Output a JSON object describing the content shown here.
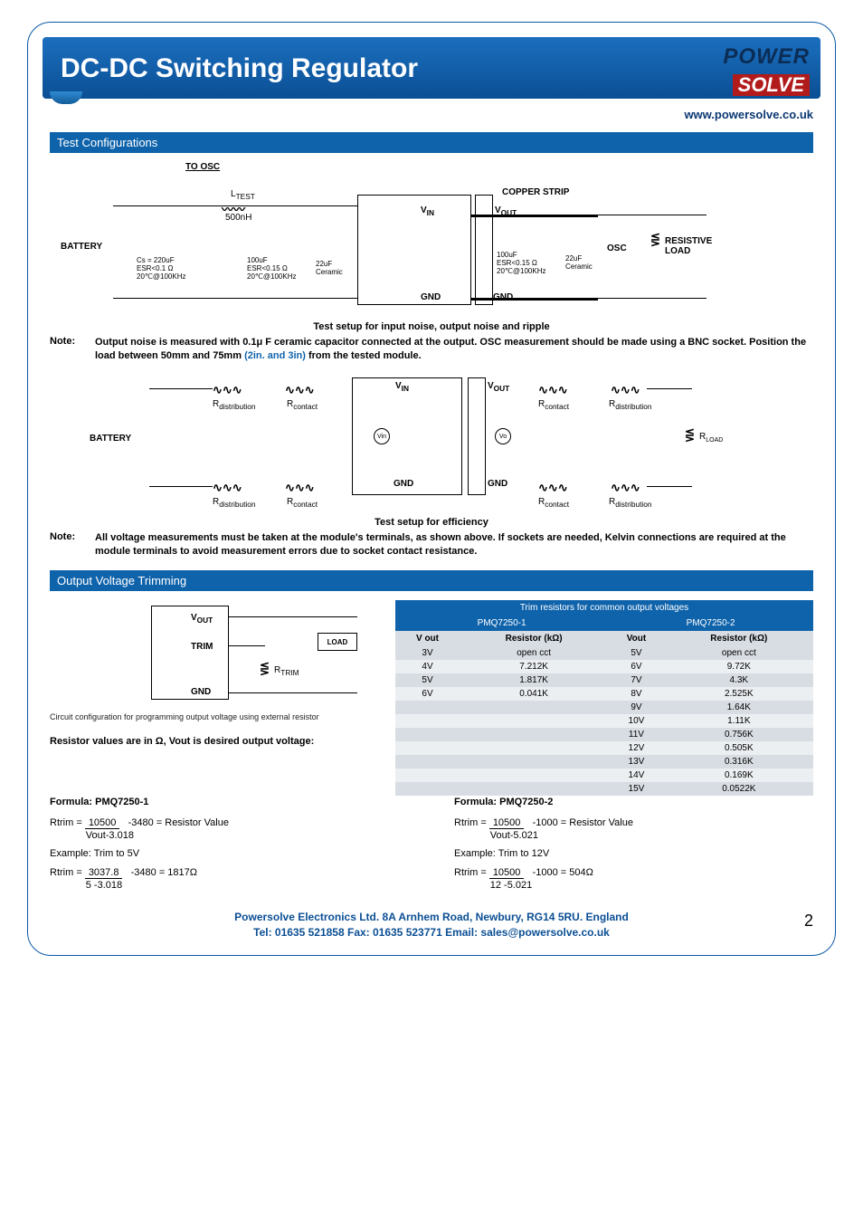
{
  "banner": {
    "title": "DC-DC Switching Regulator"
  },
  "logo": {
    "line1": "POWER",
    "line2": "SOLVE"
  },
  "url": "www.powersolve.co.uk",
  "sections": {
    "test_config": "Test Configurations",
    "trimming": "Output Voltage Trimming"
  },
  "diagram1": {
    "to_osc": "TO OSC",
    "ltest": "L",
    "ltest_sub": "TEST",
    "ltest_val": "500nH",
    "battery": "BATTERY",
    "cs": "Cs = 220uF\nESR<0.1 Ω\n20℃@100KHz",
    "c100": "100uF\nESR<0.15 Ω\n20℃@100KHz",
    "c22": "22uF\nCeramic",
    "vin": "V",
    "vin_sub": "IN",
    "gnd": "GND",
    "vout": "V",
    "vout_sub": "OUT",
    "c100b": "100uF\nESR<0.15 Ω\n20℃@100KHz",
    "c22b": "22uF\nCeramic",
    "osc": "OSC",
    "resload": "RESISTIVE\nLOAD",
    "copper": "COPPER STRIP",
    "caption": "Test setup for input noise, output noise and ripple"
  },
  "note1": {
    "label": "Note:",
    "text": "Output noise is measured with 0.1μ F ceramic capacitor connected at the output. OSC measurement should be made using a BNC socket. Position the load between 50mm and 75mm (2in. and 3in) from the tested module.",
    "paren": "(2in. and 3in)"
  },
  "diagram2": {
    "battery": "BATTERY",
    "rdist": "R",
    "rdist_sub": "distribution",
    "rcont": "R",
    "rcont_sub": "contact",
    "vin": "V",
    "vin_sub": "IN",
    "gnd": "GND",
    "vout": "V",
    "vout_sub": "OUT",
    "rload": "R",
    "rload_sub": "LOAD",
    "vin_circ": "Vin",
    "vo_circ": "Vo",
    "caption": "Test setup for efficiency"
  },
  "note2": {
    "label": "Note:",
    "text": "All voltage measurements must be taken at the module's terminals, as shown above. If sockets are needed, Kelvin connections are required at the module terminals to avoid measurement errors due to socket contact resistance."
  },
  "trim_circuit": {
    "vout": "V",
    "vout_sub": "OUT",
    "trim": "TRIM",
    "gnd": "GND",
    "load": "LOAD",
    "rtrim": "R",
    "rtrim_sub": "TRIM",
    "caption": "Circuit configuration for programming output voltage using external resistor"
  },
  "trim_note": "Resistor values are in Ω, Vout is desired output voltage:",
  "trim_table": {
    "title": "Trim resistors for common output voltages",
    "col1_hdr": "PMQ7250-1",
    "col2_hdr": "PMQ7250-2",
    "sub": [
      "V out",
      "Resistor (kΩ)",
      "Vout",
      "Resistor (kΩ)"
    ],
    "rows": [
      [
        "3V",
        "open cct",
        "5V",
        "open cct"
      ],
      [
        "4V",
        "7.212K",
        "6V",
        "9.72K"
      ],
      [
        "5V",
        "1.817K",
        "7V",
        "4.3K"
      ],
      [
        "6V",
        "0.041K",
        "8V",
        "2.525K"
      ],
      [
        "",
        "",
        "9V",
        "1.64K"
      ],
      [
        "",
        "",
        "10V",
        "1.11K"
      ],
      [
        "",
        "",
        "11V",
        "0.756K"
      ],
      [
        "",
        "",
        "12V",
        "0.505K"
      ],
      [
        "",
        "",
        "13V",
        "0.316K"
      ],
      [
        "",
        "",
        "14V",
        "0.169K"
      ],
      [
        "",
        "",
        "15V",
        "0.0522K"
      ]
    ]
  },
  "formula1": {
    "header": "Formula:   PMQ7250-1",
    "l1a": "Rtrim  =",
    "l1b": "10500",
    "l1c": "-3480 = Resistor Value",
    "l1d": "Vout-3.018",
    "ex": "Example: Trim to 5V",
    "l2a": "Rtrim  =",
    "l2b": "3037.8",
    "l2c": "-3480  = 1817Ω",
    "l2d": "5 -3.018"
  },
  "formula2": {
    "header": "Formula:   PMQ7250-2",
    "l1a": "Rtrim  =",
    "l1b": "10500",
    "l1c": "-1000 = Resistor Value",
    "l1d": "Vout-5.021",
    "ex": "Example: Trim to 12V",
    "l2a": "Rtrim  =",
    "l2b": "10500",
    "l2c": "-1000  = 504Ω",
    "l2d": "12 -5.021"
  },
  "footer": {
    "line1": "Powersolve Electronics Ltd.  8A Arnhem Road,  Newbury, RG14 5RU.  England",
    "line2": "Tel: 01635 521858  Fax: 01635 523771  Email: sales@powersolve.co.uk",
    "page": "2"
  }
}
